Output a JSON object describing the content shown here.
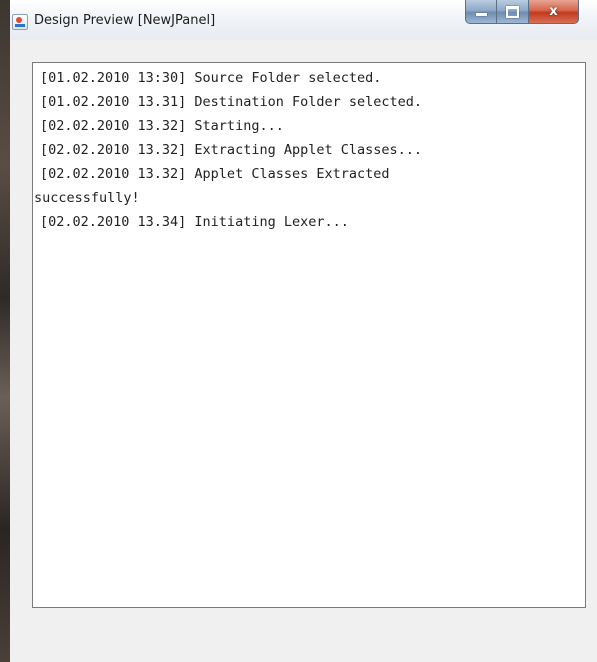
{
  "window": {
    "title": "Design Preview [NewJPanel]",
    "app_icon": "java-cup-icon",
    "controls": {
      "minimize_icon": "minimize-icon",
      "maximize_icon": "maximize-icon",
      "close_glyph": "x"
    }
  },
  "log": {
    "lines": [
      "[01.02.2010 13:30] Source Folder selected.",
      "[01.02.2010 13.31] Destination Folder selected.",
      "[02.02.2010 13.32] Starting...",
      "[02.02.2010 13.32] Extracting Applet Classes...",
      "[02.02.2010 13.32] Applet Classes Extracted",
      "successfully!",
      "[02.02.2010 13.34] Initiating Lexer..."
    ]
  }
}
